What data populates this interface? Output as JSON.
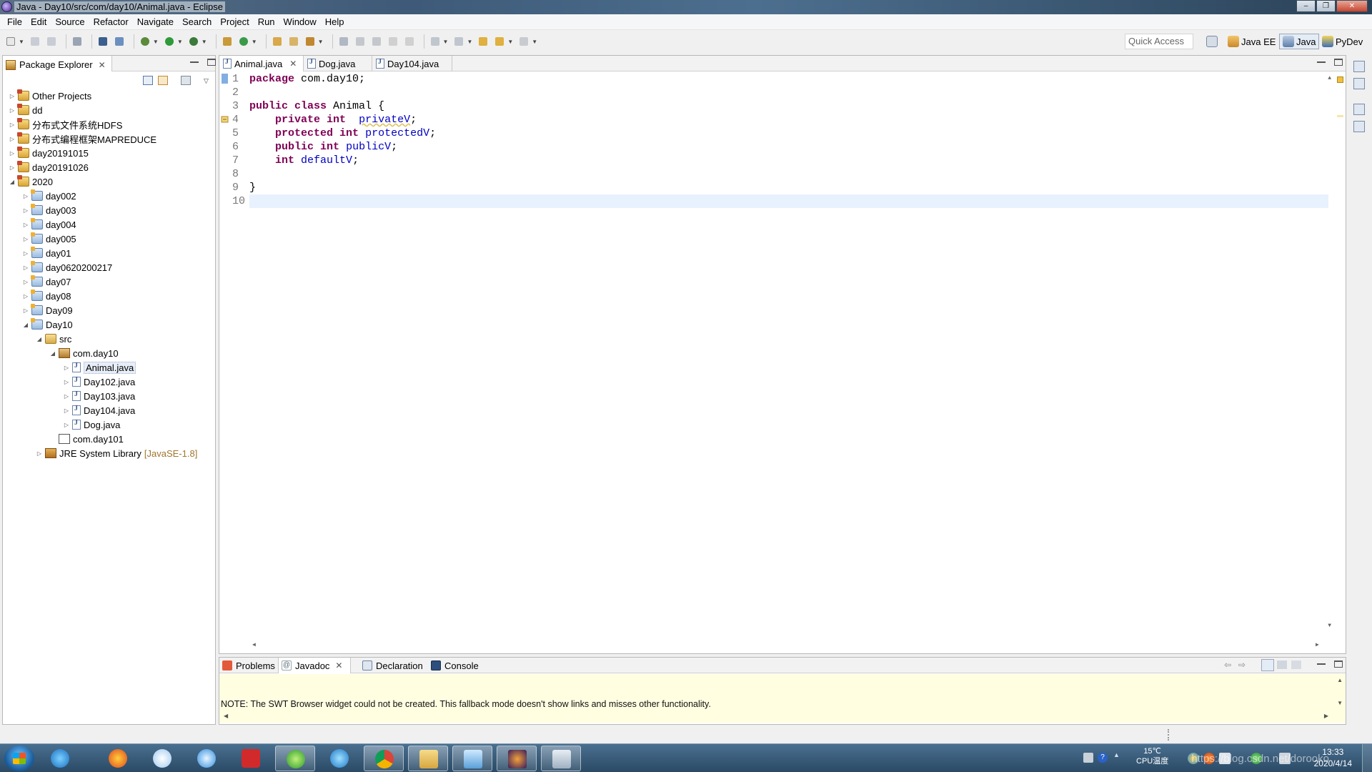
{
  "window": {
    "title": "Java - Day10/src/com/day10/Animal.java - Eclipse"
  },
  "menubar": [
    "File",
    "Edit",
    "Source",
    "Refactor",
    "Navigate",
    "Search",
    "Project",
    "Run",
    "Window",
    "Help"
  ],
  "toolbar": {
    "quick_access_placeholder": "Quick Access",
    "perspectives": [
      {
        "label": "Java EE",
        "icon": "java-ee-perspective-icon",
        "active": false
      },
      {
        "label": "Java",
        "icon": "java-perspective-icon",
        "active": true
      },
      {
        "label": "PyDev",
        "icon": "pydev-perspective-icon",
        "active": false
      }
    ]
  },
  "package_explorer": {
    "title": "Package Explorer",
    "tree": [
      {
        "label": "Other Projects",
        "depth": 0,
        "expanded": false,
        "icon": "working-set"
      },
      {
        "label": "dd",
        "depth": 0,
        "expanded": false,
        "icon": "project"
      },
      {
        "label": "分布式文件系统HDFS",
        "depth": 0,
        "expanded": false,
        "icon": "project"
      },
      {
        "label": "分布式编程框架MAPREDUCE",
        "depth": 0,
        "expanded": false,
        "icon": "project"
      },
      {
        "label": "day20191015",
        "depth": 0,
        "expanded": false,
        "icon": "project"
      },
      {
        "label": "day20191026",
        "depth": 0,
        "expanded": false,
        "icon": "project"
      },
      {
        "label": "2020",
        "depth": 0,
        "expanded": true,
        "icon": "project"
      },
      {
        "label": "day002",
        "depth": 1,
        "expanded": false,
        "icon": "jproject"
      },
      {
        "label": "day003",
        "depth": 1,
        "expanded": false,
        "icon": "jproject"
      },
      {
        "label": "day004",
        "depth": 1,
        "expanded": false,
        "icon": "jproject"
      },
      {
        "label": "day005",
        "depth": 1,
        "expanded": false,
        "icon": "jproject"
      },
      {
        "label": "day01",
        "depth": 1,
        "expanded": false,
        "icon": "jproject"
      },
      {
        "label": "day0620200217",
        "depth": 1,
        "expanded": false,
        "icon": "jproject"
      },
      {
        "label": "day07",
        "depth": 1,
        "expanded": false,
        "icon": "jproject"
      },
      {
        "label": "day08",
        "depth": 1,
        "expanded": false,
        "icon": "jproject"
      },
      {
        "label": "Day09",
        "depth": 1,
        "expanded": false,
        "icon": "jproject"
      },
      {
        "label": "Day10",
        "depth": 1,
        "expanded": true,
        "icon": "jproject"
      },
      {
        "label": "src",
        "depth": 2,
        "expanded": true,
        "icon": "src"
      },
      {
        "label": "com.day10",
        "depth": 3,
        "expanded": true,
        "icon": "pkg"
      },
      {
        "label": "Animal.java",
        "depth": 4,
        "expanded": false,
        "icon": "java",
        "selected": true
      },
      {
        "label": "Day102.java",
        "depth": 4,
        "expanded": false,
        "icon": "java"
      },
      {
        "label": "Day103.java",
        "depth": 4,
        "expanded": false,
        "icon": "java"
      },
      {
        "label": "Day104.java",
        "depth": 4,
        "expanded": false,
        "icon": "java"
      },
      {
        "label": "Dog.java",
        "depth": 4,
        "expanded": false,
        "icon": "java"
      },
      {
        "label": "com.day101",
        "depth": 3,
        "expanded": null,
        "icon": "pkg-empty"
      },
      {
        "label": "JRE System Library",
        "depth": 2,
        "expanded": false,
        "icon": "lib",
        "decoration": "[JavaSE-1.8]"
      }
    ]
  },
  "editor": {
    "tabs": [
      {
        "label": "Animal.java",
        "active": true,
        "closable": true
      },
      {
        "label": "Dog.java",
        "active": false,
        "closable": false
      },
      {
        "label": "Day104.java",
        "active": false,
        "closable": false
      }
    ],
    "current_line": 10,
    "lines": [
      [
        {
          "t": "package",
          "k": "kw"
        },
        {
          "t": " com.day10;",
          "k": ""
        }
      ],
      [],
      [
        {
          "t": "public",
          "k": "kw"
        },
        {
          "t": " ",
          "k": ""
        },
        {
          "t": "class",
          "k": "kw"
        },
        {
          "t": " Animal {",
          "k": ""
        }
      ],
      [
        {
          "t": "    ",
          "k": ""
        },
        {
          "t": "private",
          "k": "kw"
        },
        {
          "t": " ",
          "k": ""
        },
        {
          "t": "int",
          "k": "kw"
        },
        {
          "t": "  ",
          "k": ""
        },
        {
          "t": "privateV",
          "k": "fld warn"
        },
        {
          "t": ";",
          "k": ""
        }
      ],
      [
        {
          "t": "    ",
          "k": ""
        },
        {
          "t": "protected",
          "k": "kw"
        },
        {
          "t": " ",
          "k": ""
        },
        {
          "t": "int",
          "k": "kw"
        },
        {
          "t": " ",
          "k": ""
        },
        {
          "t": "protectedV",
          "k": "fld"
        },
        {
          "t": ";",
          "k": ""
        }
      ],
      [
        {
          "t": "    ",
          "k": ""
        },
        {
          "t": "public",
          "k": "kw"
        },
        {
          "t": " ",
          "k": ""
        },
        {
          "t": "int",
          "k": "kw"
        },
        {
          "t": " ",
          "k": ""
        },
        {
          "t": "publicV",
          "k": "fld"
        },
        {
          "t": ";",
          "k": ""
        }
      ],
      [
        {
          "t": "    ",
          "k": ""
        },
        {
          "t": "int",
          "k": "kw"
        },
        {
          "t": " ",
          "k": ""
        },
        {
          "t": "defaultV",
          "k": "fld"
        },
        {
          "t": ";",
          "k": ""
        }
      ],
      [],
      [
        {
          "t": "}",
          "k": ""
        }
      ],
      []
    ]
  },
  "bottom_panel": {
    "tabs": [
      {
        "label": "Problems",
        "active": false,
        "icon": "problems-icon"
      },
      {
        "label": "Javadoc",
        "active": true,
        "icon": "javadoc-icon",
        "closable": true
      },
      {
        "label": "Declaration",
        "active": false,
        "icon": "declaration-icon"
      },
      {
        "label": "Console",
        "active": false,
        "icon": "console-icon"
      }
    ],
    "javadoc_note": "NOTE: The SWT Browser widget could not be created. This fallback mode doesn't show links and misses other functionality."
  },
  "taskbar": {
    "tray_temp": "15℃",
    "tray_cpu_label": "CPU温度",
    "clock_time": "13:33",
    "clock_date": "2020/4/14",
    "watermark": "https://blog.csdn.net/dorooko"
  },
  "colors": {
    "keyword": "#7f0055",
    "field": "#0000c0",
    "current_line_bg": "#e8f2fe",
    "javadoc_bg": "#fffee1"
  }
}
